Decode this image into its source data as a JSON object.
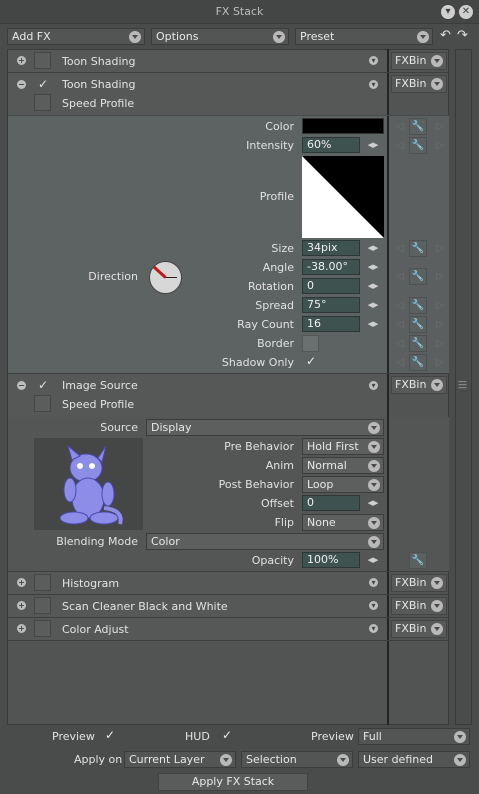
{
  "window": {
    "title": "FX Stack"
  },
  "toolbar": {
    "add_fx": "Add FX",
    "options": "Options",
    "preset": "Preset"
  },
  "fx_bin_label": "FXBin",
  "fx1": {
    "name": "Toon Shading"
  },
  "fx2": {
    "name": "Toon Shading",
    "sub": "Speed Profile",
    "params": {
      "color_label": "Color",
      "color_value": "#000000",
      "intensity_label": "Intensity",
      "intensity_value": "60%",
      "profile_label": "Profile",
      "direction_label": "Direction",
      "size_label": "Size",
      "size_value": "34pix",
      "angle_label": "Angle",
      "angle_value": "-38.00°",
      "rotation_label": "Rotation",
      "rotation_value": "0",
      "spread_label": "Spread",
      "spread_value": "75°",
      "raycount_label": "Ray Count",
      "raycount_value": "16",
      "border_label": "Border",
      "shadowonly_label": "Shadow Only"
    }
  },
  "fx3": {
    "name": "Image Source",
    "sub": "Speed Profile",
    "params": {
      "source_label": "Source",
      "source_value": "Display",
      "pre_label": "Pre Behavior",
      "pre_value": "Hold First",
      "anim_label": "Anim",
      "anim_value": "Normal",
      "post_label": "Post Behavior",
      "post_value": "Loop",
      "offset_label": "Offset",
      "offset_value": "0",
      "flip_label": "Flip",
      "flip_value": "None",
      "blend_label": "Blending Mode",
      "blend_value": "Color",
      "opacity_label": "Opacity",
      "opacity_value": "100%"
    }
  },
  "fx4": {
    "name": "Histogram"
  },
  "fx5": {
    "name": "Scan Cleaner Black and White"
  },
  "fx6": {
    "name": "Color Adjust"
  },
  "bottom": {
    "preview_label": "Preview",
    "hud_label": "HUD",
    "preview2_label": "Preview",
    "preview2_value": "Full",
    "apply_on_label": "Apply on",
    "apply_on_value": "Current Layer",
    "selection_value": "Selection",
    "user_defined_value": "User defined",
    "apply_button": "Apply FX Stack"
  },
  "icons": {
    "close": "close-icon",
    "hide": "minimize-icon",
    "undo": "undo-icon",
    "redo": "redo-icon",
    "add": "plus-circle-icon",
    "remove": "minus-circle-icon",
    "key": "wrench-icon"
  }
}
